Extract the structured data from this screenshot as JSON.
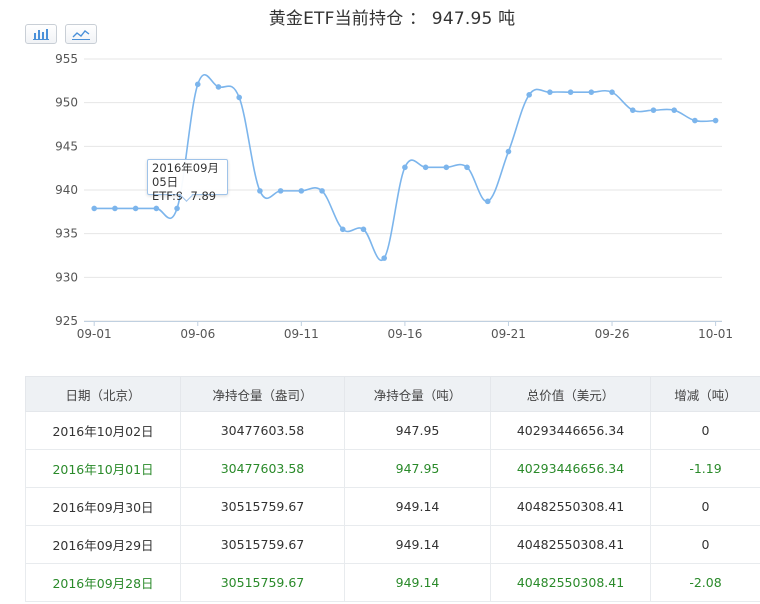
{
  "header": {
    "title": "黄金ETF当前持仓 ： 947.95 吨",
    "tools": [
      {
        "icon": "bar-chart-icon"
      },
      {
        "icon": "line-chart-icon"
      }
    ]
  },
  "tooltip": {
    "date": "2016年09月05日",
    "value_label": "ETF:937.89"
  },
  "chart_data": {
    "type": "line",
    "title": "黄金ETF当前持仓 ： 947.95 吨",
    "xlabel": "",
    "ylabel": "",
    "ylim": [
      925,
      955
    ],
    "yticks": [
      925,
      930,
      935,
      940,
      945,
      950,
      955
    ],
    "xtick_labels": [
      "09-01",
      "09-06",
      "09-11",
      "09-16",
      "09-21",
      "09-26",
      "10-01"
    ],
    "grid": true,
    "line_color": "#7cb5ec",
    "series": [
      {
        "name": "ETF",
        "x": [
          "09-01",
          "09-02",
          "09-03",
          "09-04",
          "09-05",
          "09-06",
          "09-07",
          "09-08",
          "09-09",
          "09-10",
          "09-11",
          "09-12",
          "09-13",
          "09-14",
          "09-15",
          "09-16",
          "09-17",
          "09-18",
          "09-19",
          "09-20",
          "09-21",
          "09-22",
          "09-23",
          "09-24",
          "09-25",
          "09-26",
          "09-27",
          "09-28",
          "09-29",
          "09-30",
          "10-01"
        ],
        "values": [
          937.89,
          937.89,
          937.89,
          937.89,
          937.89,
          952.1,
          951.8,
          950.6,
          939.9,
          939.9,
          939.9,
          939.9,
          935.5,
          935.5,
          932.2,
          942.6,
          942.6,
          942.6,
          942.6,
          938.7,
          944.4,
          950.9,
          951.2,
          951.2,
          951.2,
          951.2,
          949.14,
          949.14,
          949.14,
          947.95,
          947.95
        ]
      }
    ]
  },
  "table": {
    "headers": [
      "日期（北京）",
      "净持仓量（盎司）",
      "净持仓量（吨）",
      "总价值（美元）",
      "增减（吨）"
    ],
    "rows": [
      {
        "date": "2016年10月02日",
        "oz": "30477603.58",
        "ton": "947.95",
        "usd": "40293446656.34",
        "change": "0",
        "highlight": false
      },
      {
        "date": "2016年10月01日",
        "oz": "30477603.58",
        "ton": "947.95",
        "usd": "40293446656.34",
        "change": "-1.19",
        "highlight": true
      },
      {
        "date": "2016年09月30日",
        "oz": "30515759.67",
        "ton": "949.14",
        "usd": "40482550308.41",
        "change": "0",
        "highlight": false
      },
      {
        "date": "2016年09月29日",
        "oz": "30515759.67",
        "ton": "949.14",
        "usd": "40482550308.41",
        "change": "0",
        "highlight": false
      },
      {
        "date": "2016年09月28日",
        "oz": "30515759.67",
        "ton": "949.14",
        "usd": "40482550308.41",
        "change": "-2.08",
        "highlight": true
      }
    ],
    "highlight_color": "#2a8a2a"
  }
}
